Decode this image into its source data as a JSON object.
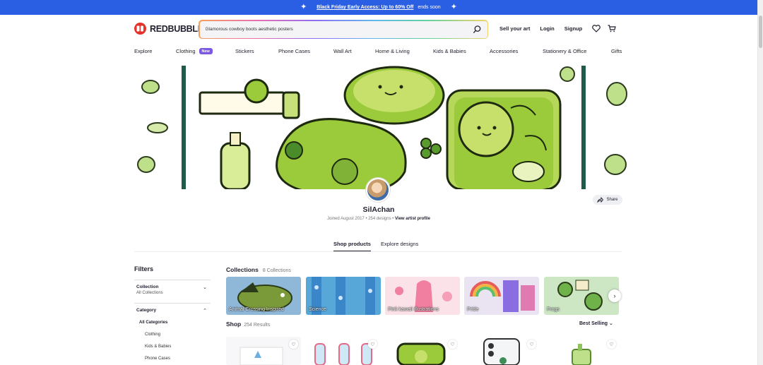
{
  "promo": {
    "link_text": "Black Friday Early Access: Up to 60% Off",
    "suffix": "ends soon",
    "spark": "✦"
  },
  "header": {
    "logo_text": "REDBUBBLE",
    "search_placeholder": "Glamorous cowboy boots aesthetic posters",
    "actions": {
      "sell": "Sell your art",
      "login": "Login",
      "signup": "Signup"
    },
    "icons": [
      "search-icon",
      "heart-icon",
      "cart-icon"
    ]
  },
  "nav": {
    "items": [
      "Explore",
      "Clothing",
      "Stickers",
      "Phone Cases",
      "Wall Art",
      "Home & Living",
      "Kids & Babies",
      "Accessories",
      "Stationery & Office",
      "Gifts"
    ],
    "badge": "New"
  },
  "artist": {
    "name": "SilAchan",
    "joined": "Joined August 2017",
    "sep": "•",
    "designs": "254 designs",
    "profile_link": "View artist profile",
    "share_label": "Share"
  },
  "tabs": {
    "active": "Shop products",
    "other": "Explore designs"
  },
  "filters": {
    "title": "Filters",
    "collection": {
      "title": "Collection",
      "value": "All Collections"
    },
    "category": {
      "title": "Category",
      "all": "All Categories",
      "items": [
        "Clothing",
        "Kids & Babies",
        "Phone Cases"
      ]
    }
  },
  "collections": {
    "title": "Collections",
    "count": "8 Collections",
    "items": [
      {
        "label": "Animal Crossing Inspired",
        "color": "#8fb7d8"
      },
      {
        "label": "Science",
        "color": "#57a7d9"
      },
      {
        "label": "Pink kawaii illustrations",
        "color": "#f2b9c8"
      },
      {
        "label": "Pride",
        "color": "#e9e3f2"
      },
      {
        "label": "Frogs",
        "color": "#cde7c5"
      }
    ]
  },
  "shop": {
    "title": "Shop",
    "count": "254 Results",
    "sort": "Best Selling"
  },
  "colors": {
    "promo": "#2b5fe3",
    "brand": "#e4322b",
    "badge": "#7b59e0",
    "green": "#9bcb3b",
    "dark": "#1f1f2e"
  }
}
